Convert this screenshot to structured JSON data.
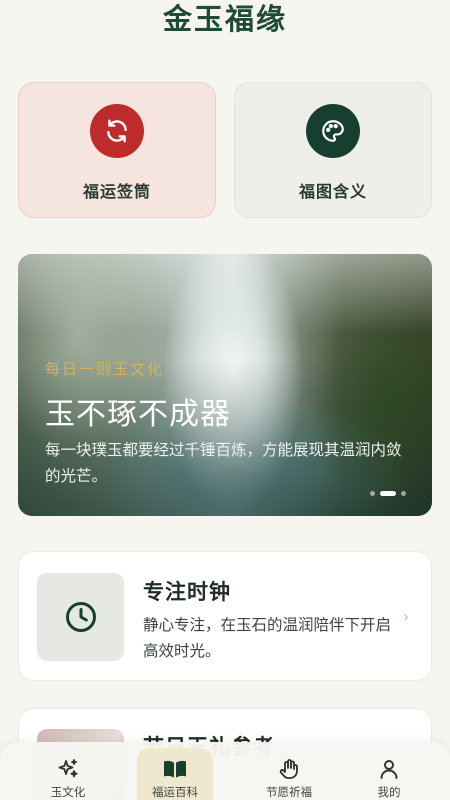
{
  "app": {
    "title": "金玉福缘"
  },
  "quick_actions": [
    {
      "label": "福运签筒",
      "icon": "refresh-icon"
    },
    {
      "label": "福图含义",
      "icon": "palette-icon"
    }
  ],
  "banner": {
    "kicker": "每日一则玉文化",
    "title": "玉不琢不成器",
    "description": "每一块璞玉都要经过千锤百炼，方能展现其温润内敛的光芒。",
    "slide_count": 3,
    "active_slide": 2
  },
  "feature_cards": [
    {
      "title": "专注时钟",
      "description": "静心专注，在玉石的温润陪伴下开启高效时光。",
      "icon": "clock-icon"
    },
    {
      "title": "节日玉礼参考"
    }
  ],
  "tabbar": {
    "items": [
      {
        "label": "玉文化",
        "icon": "sparkle-icon"
      },
      {
        "label": "福运百科",
        "icon": "book-icon",
        "active": true
      },
      {
        "label": "节愿祈福",
        "icon": "hand-icon"
      },
      {
        "label": "我的",
        "icon": "person-icon"
      }
    ]
  },
  "colors": {
    "background": "#f6f5ef",
    "brand_green": "#173f30",
    "accent_red": "#be2b2b",
    "gold": "#d4b45a"
  }
}
